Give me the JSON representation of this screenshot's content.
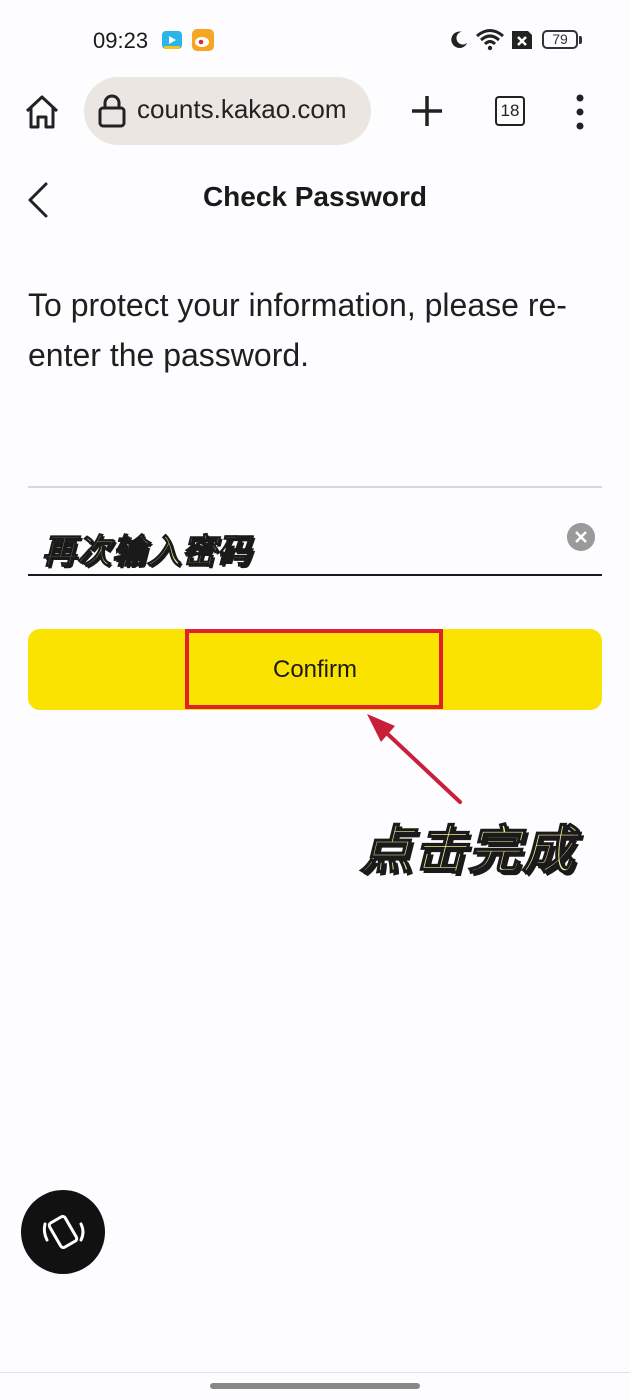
{
  "status_bar": {
    "time": "09:23",
    "battery": "79",
    "icons": [
      "video-app-icon",
      "weibo-icon",
      "moon-icon",
      "wifi-icon",
      "no-sim-icon",
      "battery-icon"
    ]
  },
  "browser": {
    "url": "counts.kakao.com",
    "tab_count": "18",
    "icons": [
      "home-icon",
      "lock-icon",
      "plus-icon",
      "tabs-icon",
      "more-vert-icon"
    ]
  },
  "page": {
    "title": "Check Password",
    "instructions": "To protect your information, please re-enter the password.",
    "password_overlay": "再次输入密码",
    "confirm_label": "Confirm"
  },
  "annotation": {
    "tap_label": "点击完成",
    "highlight_color": "#e0202a",
    "arrow_color": "#c8203a"
  },
  "colors": {
    "accent": "#fae300",
    "background": "#fdfcfe"
  }
}
